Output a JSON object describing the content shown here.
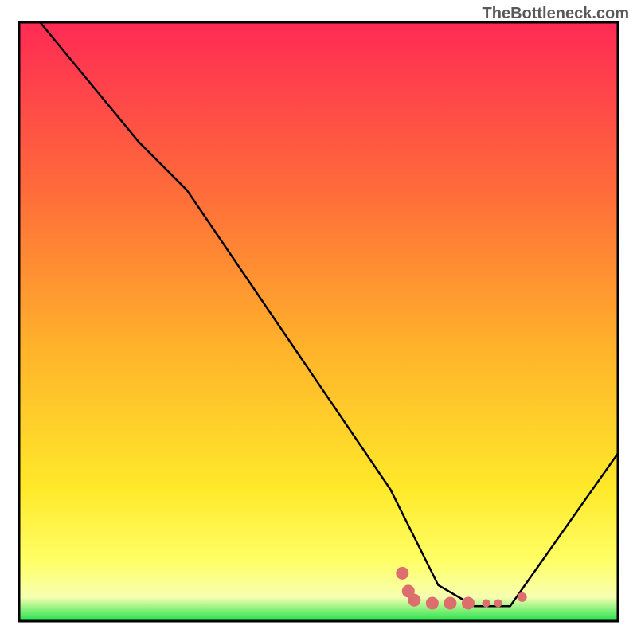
{
  "brand": "TheBottleneck.com",
  "chart_data": {
    "type": "line",
    "title": "",
    "xlabel": "",
    "ylabel": "",
    "xlim": [
      0,
      100
    ],
    "ylim": [
      0,
      100
    ],
    "gradient_stops": [
      {
        "offset": 0,
        "color": "#ff2a55"
      },
      {
        "offset": 28,
        "color": "#ff6b3a"
      },
      {
        "offset": 55,
        "color": "#ffb42a"
      },
      {
        "offset": 78,
        "color": "#ffe92a"
      },
      {
        "offset": 90,
        "color": "#ffff66"
      },
      {
        "offset": 96,
        "color": "#f7ffb0"
      },
      {
        "offset": 100,
        "color": "#1fe24a"
      }
    ],
    "series": [
      {
        "name": "curve",
        "points": [
          {
            "x": 3.5,
            "y": 100
          },
          {
            "x": 20,
            "y": 80
          },
          {
            "x": 28,
            "y": 72
          },
          {
            "x": 62,
            "y": 22
          },
          {
            "x": 66,
            "y": 14
          },
          {
            "x": 70,
            "y": 6
          },
          {
            "x": 76,
            "y": 2.5
          },
          {
            "x": 82,
            "y": 2.5
          },
          {
            "x": 100,
            "y": 28
          }
        ]
      }
    ],
    "markers": [
      {
        "x": 64,
        "y": 8,
        "r": 8,
        "color": "#dd6e6e"
      },
      {
        "x": 65,
        "y": 5,
        "r": 8,
        "color": "#dd6e6e"
      },
      {
        "x": 66,
        "y": 3.5,
        "r": 8,
        "color": "#dd6e6e"
      },
      {
        "x": 69,
        "y": 3,
        "r": 8,
        "color": "#dd6e6e"
      },
      {
        "x": 72,
        "y": 3,
        "r": 8,
        "color": "#dd6e6e"
      },
      {
        "x": 75,
        "y": 3,
        "r": 8,
        "color": "#dd6e6e"
      },
      {
        "x": 78,
        "y": 3,
        "r": 5,
        "color": "#dd6e6e"
      },
      {
        "x": 80,
        "y": 3,
        "r": 5,
        "color": "#dd6e6e"
      },
      {
        "x": 84,
        "y": 4,
        "r": 6,
        "color": "#dd6e6e"
      }
    ]
  }
}
